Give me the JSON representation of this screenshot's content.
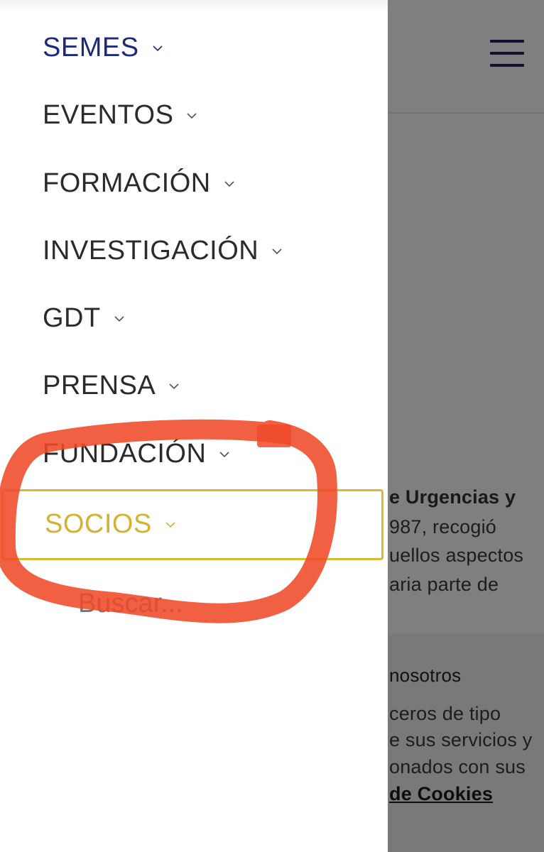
{
  "background": {
    "header": {
      "menu_icon": "hamburger-menu-icon",
      "menu_color": "#1d2660"
    },
    "article_lines": [
      "e Urgencias y",
      "987, recogió",
      "uellos aspectos",
      "aria parte de"
    ],
    "cookie_notice": {
      "title_fragment": "nosotros",
      "lines": [
        "ceros de tipo",
        "e sus servicios y",
        "onados con sus"
      ],
      "link_fragment": "de Cookies"
    }
  },
  "drawer": {
    "items": [
      {
        "label": "SEMES",
        "state": "active"
      },
      {
        "label": "EVENTOS",
        "state": "normal"
      },
      {
        "label": "FORMACIÓN",
        "state": "normal"
      },
      {
        "label": "INVESTIGACIÓN",
        "state": "normal"
      },
      {
        "label": "GDT",
        "state": "normal"
      },
      {
        "label": "PRENSA",
        "state": "normal"
      },
      {
        "label": "FUNDACIÓN",
        "state": "normal"
      },
      {
        "label": "SOCIOS",
        "state": "highlighted"
      }
    ],
    "expand_icon": "chevron-down-icon",
    "search": {
      "placeholder": "Buscar..."
    }
  },
  "colors": {
    "active": "#1d2a7a",
    "highlight": "#d4b232",
    "annotation": "#f04a2a",
    "overlay": "rgba(0,0,0,0.5)"
  }
}
